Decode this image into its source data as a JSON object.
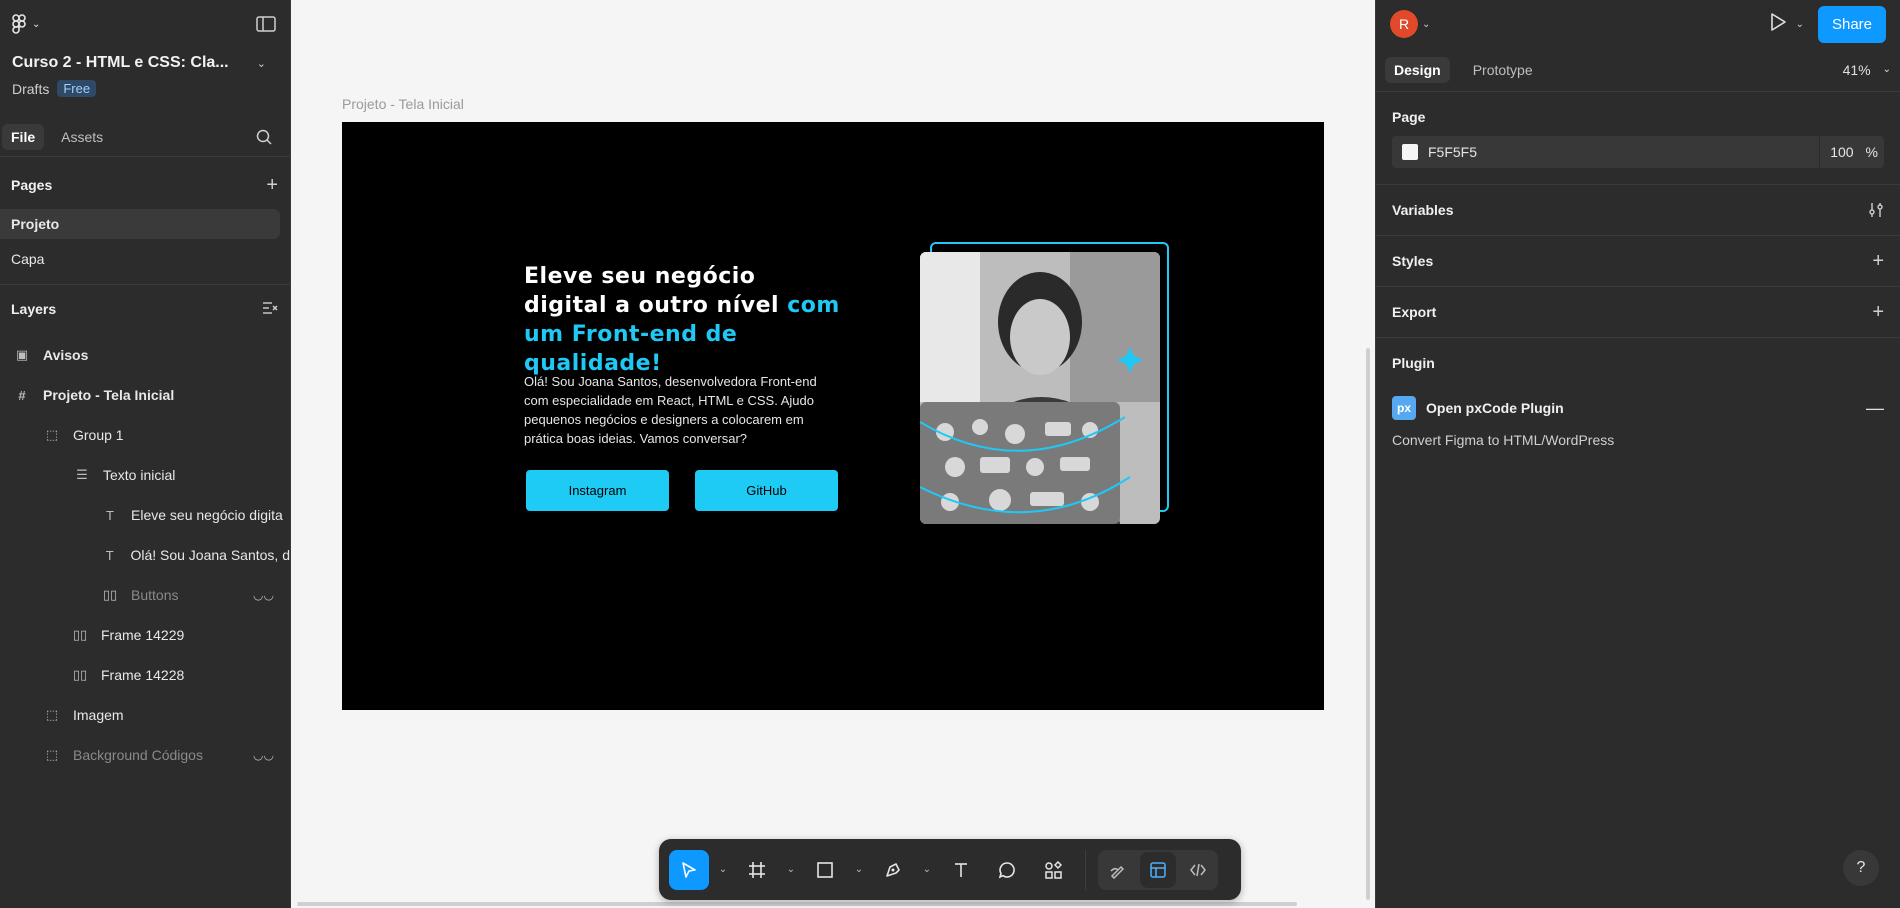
{
  "file": {
    "title": "Curso 2 - HTML e CSS: Cla...",
    "location": "Drafts",
    "plan_badge": "Free"
  },
  "left_tabs": {
    "file": "File",
    "assets": "Assets"
  },
  "pages": {
    "heading": "Pages",
    "items": [
      "Projeto",
      "Capa"
    ]
  },
  "layers": {
    "heading": "Layers",
    "items": [
      "Avisos",
      "Projeto - Tela Inicial",
      "Group 1",
      "Texto inicial",
      "Eleve seu negócio digita",
      "Olá! Sou Joana Santos, d",
      "Buttons",
      "Frame 14229",
      "Frame 14228",
      "Imagem",
      "Background Códigos"
    ]
  },
  "canvas": {
    "frame_label": "Projeto - Tela Inicial",
    "hero_title_part1": "Eleve seu negócio digital a outro nível ",
    "hero_title_accent": "com um Front-end de qualidade!",
    "hero_text": "Olá! Sou Joana Santos, desenvolvedora Front-end com especialidade em React, HTML e CSS. Ajudo pequenos negócios e designers a colocarem em prática boas ideias. Vamos conversar?",
    "button_instagram": "Instagram",
    "button_github": "GitHub",
    "accent_color": "#1fc9f5"
  },
  "right": {
    "avatar_letter": "R",
    "share_label": "Share",
    "tab_design": "Design",
    "tab_prototype": "Prototype",
    "zoom": "41%",
    "page_section": "Page",
    "page_color": "F5F5F5",
    "page_opacity": "100",
    "percent_sign": "%",
    "variables": "Variables",
    "styles": "Styles",
    "export": "Export",
    "plugin": "Plugin",
    "plugin_name": "Open pxCode Plugin",
    "plugin_desc": "Convert Figma to HTML/WordPress",
    "plugin_badge": "px"
  },
  "help_label": "?"
}
